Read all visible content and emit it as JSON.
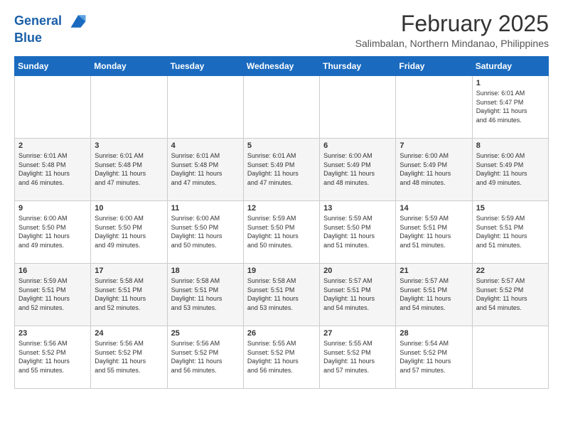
{
  "header": {
    "logo_line1": "General",
    "logo_line2": "Blue",
    "month_year": "February 2025",
    "location": "Salimbalan, Northern Mindanao, Philippines"
  },
  "days_of_week": [
    "Sunday",
    "Monday",
    "Tuesday",
    "Wednesday",
    "Thursday",
    "Friday",
    "Saturday"
  ],
  "weeks": [
    [
      {
        "day": "",
        "info": ""
      },
      {
        "day": "",
        "info": ""
      },
      {
        "day": "",
        "info": ""
      },
      {
        "day": "",
        "info": ""
      },
      {
        "day": "",
        "info": ""
      },
      {
        "day": "",
        "info": ""
      },
      {
        "day": "1",
        "info": "Sunrise: 6:01 AM\nSunset: 5:47 PM\nDaylight: 11 hours\nand 46 minutes."
      }
    ],
    [
      {
        "day": "2",
        "info": "Sunrise: 6:01 AM\nSunset: 5:48 PM\nDaylight: 11 hours\nand 46 minutes."
      },
      {
        "day": "3",
        "info": "Sunrise: 6:01 AM\nSunset: 5:48 PM\nDaylight: 11 hours\nand 47 minutes."
      },
      {
        "day": "4",
        "info": "Sunrise: 6:01 AM\nSunset: 5:48 PM\nDaylight: 11 hours\nand 47 minutes."
      },
      {
        "day": "5",
        "info": "Sunrise: 6:01 AM\nSunset: 5:49 PM\nDaylight: 11 hours\nand 47 minutes."
      },
      {
        "day": "6",
        "info": "Sunrise: 6:00 AM\nSunset: 5:49 PM\nDaylight: 11 hours\nand 48 minutes."
      },
      {
        "day": "7",
        "info": "Sunrise: 6:00 AM\nSunset: 5:49 PM\nDaylight: 11 hours\nand 48 minutes."
      },
      {
        "day": "8",
        "info": "Sunrise: 6:00 AM\nSunset: 5:49 PM\nDaylight: 11 hours\nand 49 minutes."
      }
    ],
    [
      {
        "day": "9",
        "info": "Sunrise: 6:00 AM\nSunset: 5:50 PM\nDaylight: 11 hours\nand 49 minutes."
      },
      {
        "day": "10",
        "info": "Sunrise: 6:00 AM\nSunset: 5:50 PM\nDaylight: 11 hours\nand 49 minutes."
      },
      {
        "day": "11",
        "info": "Sunrise: 6:00 AM\nSunset: 5:50 PM\nDaylight: 11 hours\nand 50 minutes."
      },
      {
        "day": "12",
        "info": "Sunrise: 5:59 AM\nSunset: 5:50 PM\nDaylight: 11 hours\nand 50 minutes."
      },
      {
        "day": "13",
        "info": "Sunrise: 5:59 AM\nSunset: 5:50 PM\nDaylight: 11 hours\nand 51 minutes."
      },
      {
        "day": "14",
        "info": "Sunrise: 5:59 AM\nSunset: 5:51 PM\nDaylight: 11 hours\nand 51 minutes."
      },
      {
        "day": "15",
        "info": "Sunrise: 5:59 AM\nSunset: 5:51 PM\nDaylight: 11 hours\nand 51 minutes."
      }
    ],
    [
      {
        "day": "16",
        "info": "Sunrise: 5:59 AM\nSunset: 5:51 PM\nDaylight: 11 hours\nand 52 minutes."
      },
      {
        "day": "17",
        "info": "Sunrise: 5:58 AM\nSunset: 5:51 PM\nDaylight: 11 hours\nand 52 minutes."
      },
      {
        "day": "18",
        "info": "Sunrise: 5:58 AM\nSunset: 5:51 PM\nDaylight: 11 hours\nand 53 minutes."
      },
      {
        "day": "19",
        "info": "Sunrise: 5:58 AM\nSunset: 5:51 PM\nDaylight: 11 hours\nand 53 minutes."
      },
      {
        "day": "20",
        "info": "Sunrise: 5:57 AM\nSunset: 5:51 PM\nDaylight: 11 hours\nand 54 minutes."
      },
      {
        "day": "21",
        "info": "Sunrise: 5:57 AM\nSunset: 5:51 PM\nDaylight: 11 hours\nand 54 minutes."
      },
      {
        "day": "22",
        "info": "Sunrise: 5:57 AM\nSunset: 5:52 PM\nDaylight: 11 hours\nand 54 minutes."
      }
    ],
    [
      {
        "day": "23",
        "info": "Sunrise: 5:56 AM\nSunset: 5:52 PM\nDaylight: 11 hours\nand 55 minutes."
      },
      {
        "day": "24",
        "info": "Sunrise: 5:56 AM\nSunset: 5:52 PM\nDaylight: 11 hours\nand 55 minutes."
      },
      {
        "day": "25",
        "info": "Sunrise: 5:56 AM\nSunset: 5:52 PM\nDaylight: 11 hours\nand 56 minutes."
      },
      {
        "day": "26",
        "info": "Sunrise: 5:55 AM\nSunset: 5:52 PM\nDaylight: 11 hours\nand 56 minutes."
      },
      {
        "day": "27",
        "info": "Sunrise: 5:55 AM\nSunset: 5:52 PM\nDaylight: 11 hours\nand 57 minutes."
      },
      {
        "day": "28",
        "info": "Sunrise: 5:54 AM\nSunset: 5:52 PM\nDaylight: 11 hours\nand 57 minutes."
      },
      {
        "day": "",
        "info": ""
      }
    ]
  ]
}
